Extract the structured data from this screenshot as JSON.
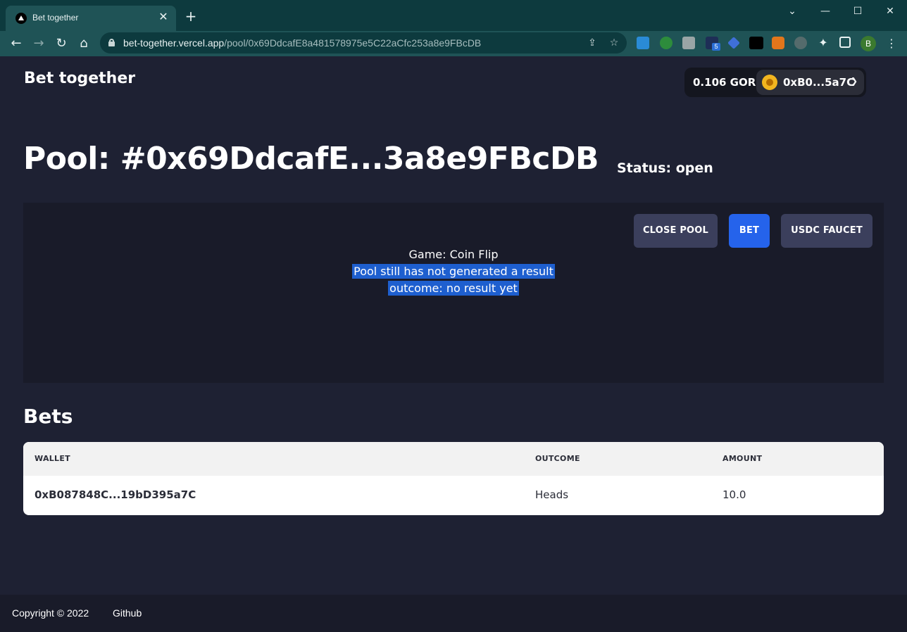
{
  "browser": {
    "tab_title": "Bet together",
    "url_host": "bet-together.vercel.app",
    "url_path": "/pool/0x69DdcafE8a481578975e5C22aCfc253a8e9FBcDB",
    "profile_initial": "B",
    "extension_badge": "5"
  },
  "header": {
    "brand": "Bet together",
    "balance": "0.106 GOR",
    "account": "0xB0...5a7C"
  },
  "pool": {
    "title": "Pool: #0x69DdcafE...3a8e9FBcDB",
    "status": "Status: open",
    "buttons": {
      "close_pool": "CLOSE POOL",
      "bet": "BET",
      "usdc_faucet": "USDC FAUCET"
    },
    "game": "Game: Coin Flip",
    "result_message": "Pool still has not generated a result",
    "outcome": "outcome: no result yet"
  },
  "bets": {
    "title": "Bets",
    "columns": [
      "WALLET",
      "OUTCOME",
      "AMOUNT"
    ],
    "rows": [
      {
        "wallet": "0xB087848C...19bD395a7C",
        "outcome": "Heads",
        "amount": "10.0"
      }
    ]
  },
  "footer": {
    "copyright": "Copyright © 2022",
    "github": "Github"
  },
  "colors": {
    "page_bg": "#1e2133",
    "panel_bg": "#191b29",
    "accent": "#2563eb",
    "selection": "#1e5fcf"
  }
}
